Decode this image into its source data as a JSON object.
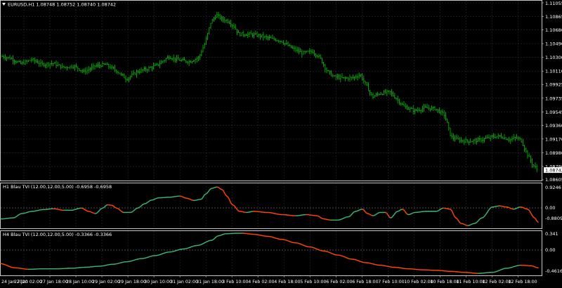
{
  "colors": {
    "background": "#000000",
    "axis": "#c8c8c8",
    "grid": "#2a2a40",
    "candle": "#00c800",
    "line_green": "#3cb371",
    "line_red": "#ff4500",
    "zero_line": "#c0c0c0",
    "price_tag_bg": "#ffffff",
    "price_tag_fg": "#000000"
  },
  "main_panel": {
    "title": "EURUSD,H1  1.08748 1.08752 1.08740 1.08742",
    "symbol_menu_icon": "triangle-down-icon",
    "current_price_label": "1.08742",
    "current_price": 1.08742,
    "y_labels": [
      "1.11055",
      "1.10865",
      "1.10680",
      "1.10490",
      "1.10300",
      "1.10110",
      "1.09925",
      "1.09735",
      "1.09545",
      "1.09360",
      "1.09170",
      "1.08980",
      "1.08790",
      "1.08605"
    ]
  },
  "h1_panel": {
    "title": "H1 Blau TVI (12.00,12.00,5.00) -0.6958 -0.6958",
    "y_labels": [
      "0.9246",
      "0.00",
      "-0.8809"
    ]
  },
  "h4_panel": {
    "title": "H4 Blau TVI (12.00,12.00,5.00) -0.3366 -0.3366",
    "y_labels": [
      "0.341",
      "0.00",
      "-0.4616"
    ]
  },
  "x_labels": [
    "24 Jan 2020",
    "27 Jan 02:00",
    "27 Jan 18:00",
    "28 Jan 10:00",
    "29 Jan 02:00",
    "29 Jan 18:00",
    "30 Jan 10:00",
    "31 Jan 02:00",
    "31 Jan 18:00",
    "3 Feb 10:00",
    "4 Feb 02:00",
    "4 Feb 18:00",
    "5 Feb 10:00",
    "6 Feb 02:00",
    "6 Feb 18:00",
    "7 Feb 10:00",
    "10 Feb 02:00",
    "10 Feb 18:00",
    "11 Feb 10:00",
    "12 Feb 02:00",
    "12 Feb 18:00"
  ],
  "chart_data": [
    {
      "type": "candlestick",
      "title": "EURUSD,H1  1.08748 1.08752 1.08740 1.08742",
      "ylim": [
        1.08605,
        1.11055
      ],
      "close_path": [
        {
          "x": 0,
          "y": 1.1032
        },
        {
          "x": 14,
          "y": 1.1029
        },
        {
          "x": 30,
          "y": 1.1021
        },
        {
          "x": 45,
          "y": 1.1027
        },
        {
          "x": 60,
          "y": 1.102
        },
        {
          "x": 75,
          "y": 1.1022
        },
        {
          "x": 90,
          "y": 1.1016
        },
        {
          "x": 105,
          "y": 1.1018
        },
        {
          "x": 120,
          "y": 1.101
        },
        {
          "x": 135,
          "y": 1.1018
        },
        {
          "x": 150,
          "y": 1.102
        },
        {
          "x": 165,
          "y": 1.1012
        },
        {
          "x": 180,
          "y": 1.1
        },
        {
          "x": 195,
          "y": 1.101
        },
        {
          "x": 210,
          "y": 1.1014
        },
        {
          "x": 225,
          "y": 1.102
        },
        {
          "x": 240,
          "y": 1.1031
        },
        {
          "x": 255,
          "y": 1.1026
        },
        {
          "x": 270,
          "y": 1.1024
        },
        {
          "x": 283,
          "y": 1.103
        },
        {
          "x": 292,
          "y": 1.105
        },
        {
          "x": 300,
          "y": 1.1078
        },
        {
          "x": 308,
          "y": 1.1089
        },
        {
          "x": 316,
          "y": 1.1083
        },
        {
          "x": 325,
          "y": 1.108
        },
        {
          "x": 333,
          "y": 1.1073
        },
        {
          "x": 340,
          "y": 1.1062
        },
        {
          "x": 355,
          "y": 1.1062
        },
        {
          "x": 370,
          "y": 1.106
        },
        {
          "x": 385,
          "y": 1.1056
        },
        {
          "x": 400,
          "y": 1.1053
        },
        {
          "x": 415,
          "y": 1.1043
        },
        {
          "x": 430,
          "y": 1.1036
        },
        {
          "x": 445,
          "y": 1.1038
        },
        {
          "x": 455,
          "y": 1.103
        },
        {
          "x": 465,
          "y": 1.1012
        },
        {
          "x": 475,
          "y": 1.1003
        },
        {
          "x": 490,
          "y": 1.1001
        },
        {
          "x": 503,
          "y": 1.1002
        },
        {
          "x": 513,
          "y": 1.1006
        },
        {
          "x": 522,
          "y": 1.099
        },
        {
          "x": 530,
          "y": 1.0975
        },
        {
          "x": 540,
          "y": 1.098
        },
        {
          "x": 555,
          "y": 1.0982
        },
        {
          "x": 565,
          "y": 1.0972
        },
        {
          "x": 575,
          "y": 1.0962
        },
        {
          "x": 590,
          "y": 1.0956
        },
        {
          "x": 605,
          "y": 1.096
        },
        {
          "x": 620,
          "y": 1.0959
        },
        {
          "x": 633,
          "y": 1.095
        },
        {
          "x": 642,
          "y": 1.092
        },
        {
          "x": 655,
          "y": 1.0915
        },
        {
          "x": 670,
          "y": 1.0914
        },
        {
          "x": 685,
          "y": 1.0916
        },
        {
          "x": 700,
          "y": 1.092
        },
        {
          "x": 712,
          "y": 1.0921
        },
        {
          "x": 725,
          "y": 1.0916
        },
        {
          "x": 735,
          "y": 1.0919
        },
        {
          "x": 742,
          "y": 1.0915
        },
        {
          "x": 750,
          "y": 1.0897
        },
        {
          "x": 758,
          "y": 1.0882
        },
        {
          "x": 765,
          "y": 1.0874
        }
      ]
    },
    {
      "type": "line",
      "title": "H1 Blau TVI (12.00,12.00,5.00) -0.6958 -0.6958",
      "ylim": [
        -0.8809,
        0.9246
      ],
      "series_colors": "green when rising, red when falling",
      "x": [
        0,
        18,
        30,
        45,
        60,
        75,
        90,
        100,
        115,
        125,
        135,
        145,
        152,
        158,
        165,
        175,
        185,
        195,
        205,
        215,
        225,
        240,
        255,
        265,
        275,
        285,
        292,
        300,
        308,
        315,
        322,
        330,
        340,
        350,
        360,
        380,
        400,
        420,
        435,
        450,
        460,
        470,
        480,
        495,
        505,
        515,
        522,
        530,
        540,
        548,
        555,
        565,
        572,
        580,
        590,
        605,
        620,
        630,
        640,
        648,
        655,
        665,
        675,
        685,
        700,
        710,
        720,
        730,
        740,
        750,
        760,
        765
      ],
      "values": [
        -0.55,
        -0.5,
        -0.3,
        -0.2,
        -0.12,
        -0.08,
        -0.15,
        -0.15,
        -0.05,
        -0.2,
        -0.3,
        -0.05,
        0.1,
        0.08,
        -0.05,
        -0.25,
        -0.25,
        -0.05,
        0.15,
        0.32,
        0.42,
        0.45,
        0.5,
        0.4,
        0.3,
        0.35,
        0.6,
        0.85,
        0.92,
        0.8,
        0.5,
        0.1,
        -0.2,
        -0.25,
        -0.2,
        -0.25,
        -0.35,
        -0.4,
        -0.35,
        -0.4,
        -0.55,
        -0.6,
        -0.6,
        -0.45,
        -0.2,
        -0.1,
        -0.3,
        -0.4,
        -0.25,
        -0.25,
        -0.5,
        -0.2,
        -0.1,
        -0.35,
        -0.25,
        -0.2,
        -0.2,
        -0.05,
        -0.1,
        -0.5,
        -0.75,
        -0.85,
        -0.75,
        -0.5,
        0.0,
        0.05,
        0.0,
        -0.1,
        0.0,
        -0.1,
        -0.5,
        -0.7
      ]
    },
    {
      "type": "line",
      "title": "H4 Blau TVI (12.00,12.00,5.00) -0.3366 -0.3366",
      "ylim": [
        -0.4616,
        0.341
      ],
      "series_colors": "green when rising, red when falling",
      "x": [
        0,
        20,
        40,
        60,
        80,
        100,
        120,
        140,
        160,
        180,
        200,
        220,
        240,
        260,
        280,
        300,
        310,
        320,
        335,
        345,
        360,
        380,
        400,
        420,
        440,
        460,
        480,
        500,
        520,
        540,
        560,
        580,
        600,
        620,
        640,
        660,
        680,
        700,
        720,
        740,
        755,
        765
      ],
      "values": [
        -0.26,
        -0.34,
        -0.37,
        -0.36,
        -0.36,
        -0.35,
        -0.33,
        -0.31,
        -0.27,
        -0.22,
        -0.16,
        -0.1,
        -0.03,
        0.03,
        0.1,
        0.2,
        0.29,
        0.33,
        0.34,
        0.34,
        0.32,
        0.28,
        0.22,
        0.15,
        0.07,
        -0.01,
        -0.09,
        -0.17,
        -0.24,
        -0.29,
        -0.33,
        -0.36,
        -0.38,
        -0.39,
        -0.41,
        -0.43,
        -0.45,
        -0.43,
        -0.35,
        -0.29,
        -0.3,
        -0.34
      ]
    }
  ]
}
